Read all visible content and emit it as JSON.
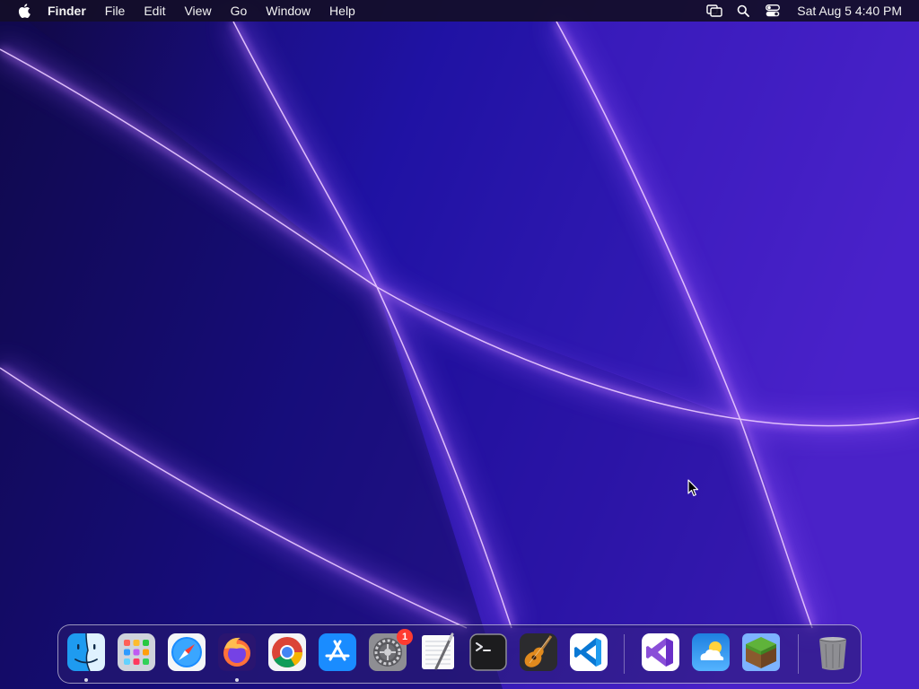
{
  "menubar": {
    "app_name": "Finder",
    "items": [
      "File",
      "Edit",
      "View",
      "Go",
      "Window",
      "Help"
    ],
    "clock": "Sat Aug 5  4:40 PM",
    "status_icons": [
      "screen-mirroring-icon",
      "spotlight-search-icon",
      "control-center-icon"
    ]
  },
  "dock": {
    "apps": [
      {
        "name": "finder",
        "running": true
      },
      {
        "name": "launchpad",
        "running": false
      },
      {
        "name": "safari",
        "running": false
      },
      {
        "name": "firefox",
        "running": true
      },
      {
        "name": "chrome",
        "running": false
      },
      {
        "name": "app-store",
        "running": false
      },
      {
        "name": "system-settings",
        "running": false,
        "badge": "1"
      },
      {
        "name": "textedit",
        "running": false
      },
      {
        "name": "terminal",
        "running": false
      },
      {
        "name": "garageband",
        "running": false
      },
      {
        "name": "vscode",
        "running": false
      },
      {
        "name": "visual-studio",
        "running": false
      },
      {
        "name": "weather",
        "running": false
      },
      {
        "name": "minecraft",
        "running": false
      },
      {
        "name": "trash",
        "running": false
      }
    ]
  },
  "colors": {
    "wallpaper_dark": "#10084a",
    "wallpaper_mid": "#2a16b0",
    "wallpaper_light": "#4a22c8",
    "glow": "#c27cff",
    "badge": "#ff3b30"
  }
}
